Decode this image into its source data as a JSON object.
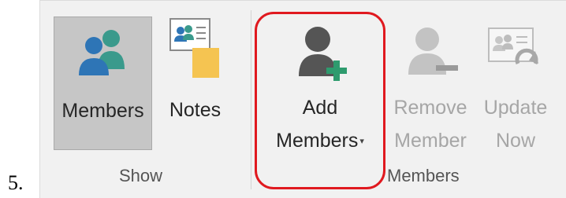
{
  "step_number": "5.",
  "ribbon": {
    "groups": [
      {
        "label": "Show",
        "buttons": [
          {
            "label": "Members",
            "icon": "people-icon",
            "state": "pressed"
          },
          {
            "label": "Notes",
            "icon": "contact-notes-icon",
            "state": "enabled"
          }
        ]
      },
      {
        "label": "Members",
        "buttons": [
          {
            "label_line1": "Add",
            "label_line2": "Members",
            "icon": "add-person-icon",
            "state": "enabled",
            "has_dropdown": true,
            "dropdown_glyph": "▾"
          },
          {
            "label_line1": "Remove",
            "label_line2": "Member",
            "icon": "remove-person-icon",
            "state": "disabled"
          },
          {
            "label_line1": "Update",
            "label_line2": "Now",
            "icon": "refresh-card-icon",
            "state": "disabled"
          }
        ]
      }
    ]
  },
  "highlight": {
    "target": "Add Members",
    "color": "#e0191f"
  },
  "colors": {
    "ribbon_bg": "#f1f1f1",
    "pressed_bg": "#c6c6c6",
    "teal_icon": "#3a9a8c",
    "blue_icon": "#2e75b6",
    "gray_icon": "#555555",
    "green_plus": "#2e9b6e",
    "notes_yellow": "#f5c451"
  }
}
